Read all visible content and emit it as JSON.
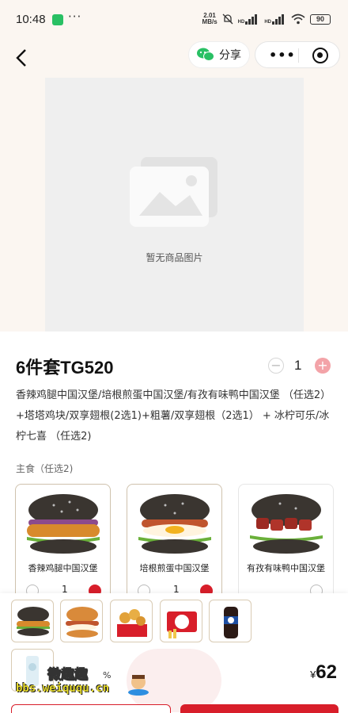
{
  "status": {
    "time": "10:48",
    "speed_value": "2.01",
    "speed_unit": "MB/s",
    "hd1": "HD",
    "hd2": "HD",
    "battery": "90"
  },
  "nav": {
    "share_label": "分享"
  },
  "hero": {
    "placeholder_text": "暂无商品图片"
  },
  "product": {
    "title": "6件套TG520",
    "quantity": "1",
    "minus": "−",
    "plus": "+",
    "description": "香辣鸡腿中国汉堡/培根煎蛋中国汉堡/有孜有味鸭中国汉堡 （任选2） +塔塔鸡块/双享翅根(2选1)+粗薯/双享翅根（2选1） + 冰柠可乐/冰柠七喜 （任选2)"
  },
  "section": {
    "title": "主食（任选2)"
  },
  "cards": [
    {
      "name": "香辣鸡腿中国汉堡",
      "qty": "1"
    },
    {
      "name": "培根煎蛋中国汉堡",
      "qty": "1"
    },
    {
      "name": "有孜有味鸭中国汉堡",
      "qty": ""
    }
  ],
  "bottom": {
    "currency": "¥",
    "price": "62",
    "partial_text": "%",
    "watermark_cn": "微趣趣",
    "watermark_url": "bbs.weiququ.cn"
  },
  "colors": {
    "accent": "#d81e2a",
    "cream": "#fbf6f1",
    "wechat_green": "#29c064"
  }
}
